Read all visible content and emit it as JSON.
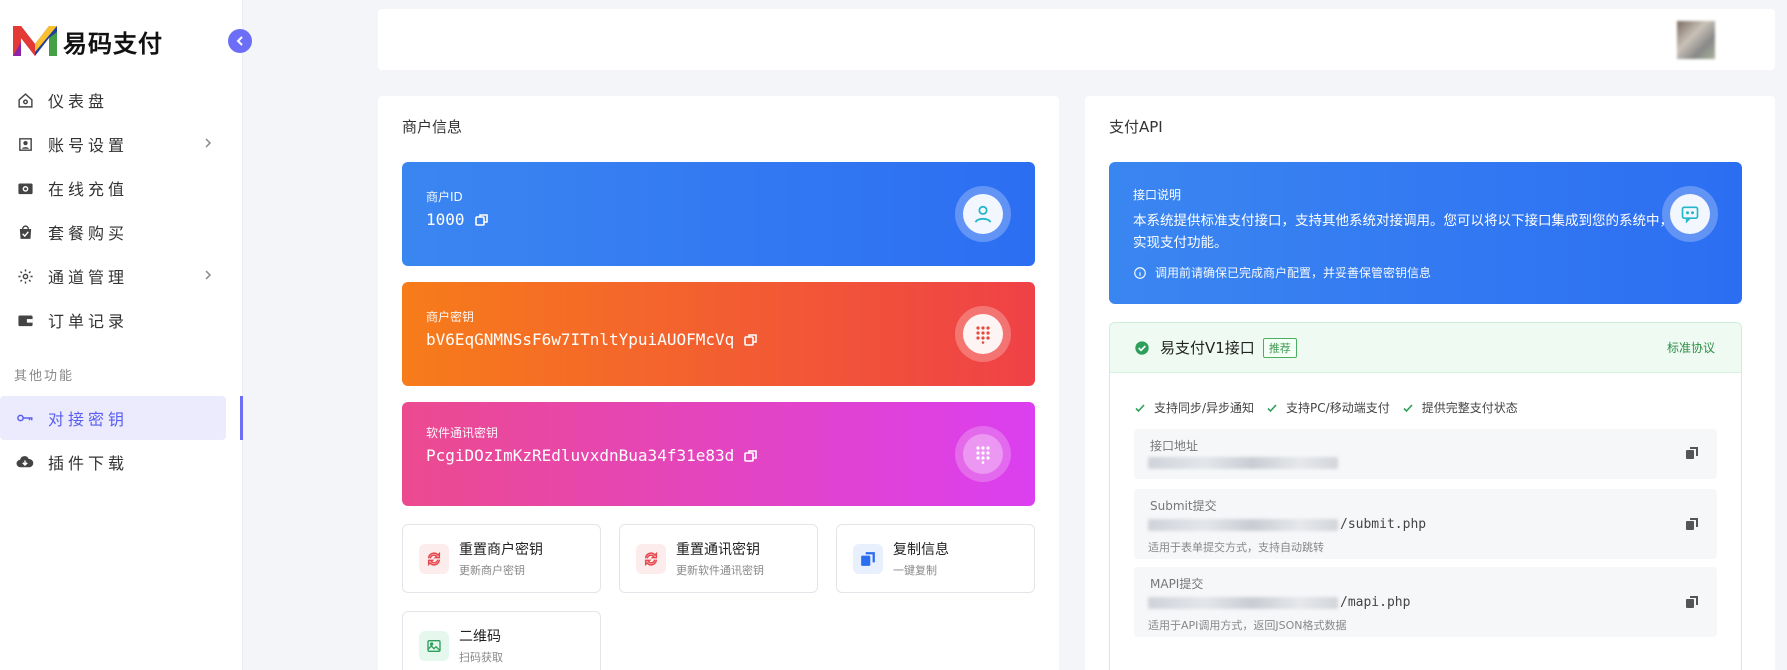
{
  "brand": {
    "name": "易码支付"
  },
  "sidebar": {
    "items": [
      {
        "label": "仪表盘",
        "icon": "home-icon"
      },
      {
        "label": "账号设置",
        "icon": "id-card-icon",
        "has_children": true
      },
      {
        "label": "在线充值",
        "icon": "camera-icon"
      },
      {
        "label": "套餐购买",
        "icon": "shopping-bag-icon"
      },
      {
        "label": "通道管理",
        "icon": "gear-icon",
        "has_children": true
      },
      {
        "label": "订单记录",
        "icon": "wallet-icon"
      }
    ],
    "section_label": "其他功能",
    "other_items": [
      {
        "label": "对接密钥",
        "icon": "key-icon",
        "active": true
      },
      {
        "label": "插件下载",
        "icon": "cloud-download-icon"
      }
    ]
  },
  "merchant": {
    "title": "商户信息",
    "id_label": "商户ID",
    "id_value": "1000",
    "key_label": "商户密钥",
    "key_value": "bV6EqGNMNSsF6w7ITnltYpuiAUOFMcVq",
    "comm_key_label": "软件通讯密钥",
    "comm_key_value": "PcgiDOzImKzREdluvxdnBua34f31e83d",
    "actions": [
      {
        "title": "重置商户密钥",
        "subtitle": "更新商户密钥"
      },
      {
        "title": "重置通讯密钥",
        "subtitle": "更新软件通讯密钥"
      },
      {
        "title": "复制信息",
        "subtitle": "一键复制"
      },
      {
        "title": "二维码",
        "subtitle": "扫码获取"
      }
    ]
  },
  "api": {
    "title": "支付API",
    "banner_label": "接口说明",
    "banner_desc": "本系统提供标准支付接口，支持其他系统对接调用。您可以将以下接口集成到您的系统中，实现支付功能。",
    "banner_note": "调用前请确保已完成商户配置，并妥善保管密钥信息",
    "v1": {
      "title": "易支付V1接口",
      "badge": "推荐",
      "protocol": "标准协议",
      "features": [
        "支持同步/异步通知",
        "支持PC/移动端支付",
        "提供完整支付状态"
      ],
      "fields": [
        {
          "label": "接口地址",
          "value": "",
          "hint": ""
        },
        {
          "label": "Submit提交",
          "value": "/submit.php",
          "hint": "适用于表单提交方式，支持自动跳转"
        },
        {
          "label": "MAPI提交",
          "value": "/mapi.php",
          "hint": "适用于API调用方式，返回JSON格式数据"
        }
      ]
    }
  },
  "colors": {
    "accent": "#6c6ff5",
    "blue_card": "#2c6ef2",
    "orange_card": "#f77c1a",
    "red_card": "#ef4147",
    "pink_card": "#ec4a8f",
    "purple_card": "#db3ff0",
    "success": "#2e8f48"
  }
}
